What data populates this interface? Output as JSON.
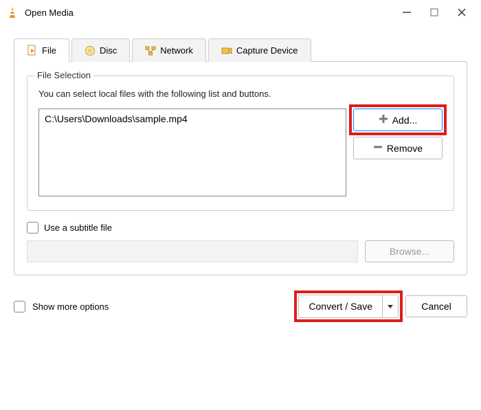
{
  "window": {
    "title": "Open Media"
  },
  "tabs": {
    "file": "File",
    "disc": "Disc",
    "network": "Network",
    "capture": "Capture Device"
  },
  "file_selection": {
    "legend": "File Selection",
    "hint": "You can select local files with the following list and buttons.",
    "files": [
      "C:\\Users\\Downloads\\sample.mp4"
    ],
    "add_label": "Add...",
    "remove_label": "Remove"
  },
  "subtitle": {
    "checkbox_label": "Use a subtitle file",
    "browse_label": "Browse..."
  },
  "footer": {
    "show_more_label": "Show more options",
    "convert_label": "Convert / Save",
    "cancel_label": "Cancel"
  }
}
